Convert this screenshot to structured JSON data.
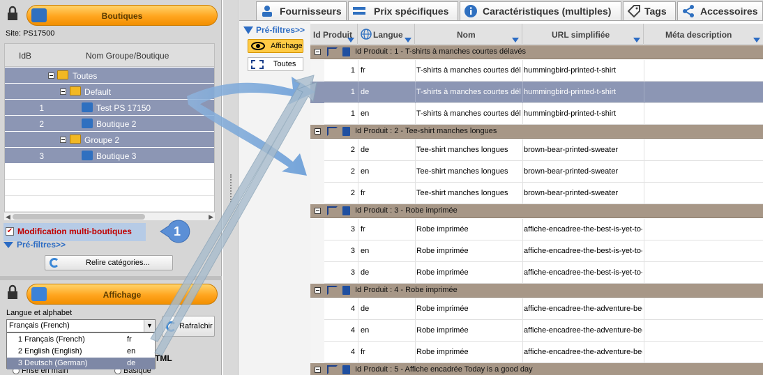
{
  "left": {
    "boutiques_title": "Boutiques",
    "site_label": "Site: PS17500",
    "grid_headers": {
      "idb": "IdB",
      "name": "Nom Groupe/Boutique"
    },
    "tree": [
      {
        "idb": "",
        "name": "Toutes"
      },
      {
        "idb": "",
        "name": "Default"
      },
      {
        "idb": "1",
        "name": "Test PS 17150"
      },
      {
        "idb": "2",
        "name": "Boutique 2"
      },
      {
        "idb": "",
        "name": "Groupe 2"
      },
      {
        "idb": "3",
        "name": "Boutique 3"
      }
    ],
    "multi_shop_label": "Modification multi-boutiques",
    "callout_number": "1",
    "prefilter_label": "Pré-filtres>>",
    "reload_label": "Relire catégories...",
    "affichage_title": "Affichage",
    "lang_label": "Langue et alphabet",
    "lang_selected": "Français (French)",
    "refresh_label": "Rafraîchir",
    "lang_options": [
      {
        "n": "1",
        "label": "Français (French)",
        "code": "fr"
      },
      {
        "n": "2",
        "label": "English (English)",
        "code": "en"
      },
      {
        "n": "3",
        "label": "Deutsch (German)",
        "code": "de"
      }
    ],
    "tml_label": "TML",
    "frise_label": "Frise en main",
    "basique_label": "Basique"
  },
  "tabs": [
    {
      "label": "Fournisseurs",
      "icon": "supplier-icon"
    },
    {
      "label": "Prix spécifiques",
      "icon": "price-icon"
    },
    {
      "label": "Caractéristiques (multiples)",
      "icon": "info-icon"
    },
    {
      "label": "Tags",
      "icon": "tag-icon"
    },
    {
      "label": "Accessoires",
      "icon": "share-icon"
    }
  ],
  "filters": {
    "prefilter_label": "Pré-filtres>>",
    "affichage_label": "Affichage",
    "toutes_label": "Toutes"
  },
  "grid": {
    "headers": {
      "id": "Id Produit",
      "lang": "Langue",
      "name": "Nom",
      "url": "URL simplifiée",
      "meta": "Méta description"
    },
    "groups": [
      {
        "title": "Id Produit : 1 - T-shirts à manches courtes délavés",
        "rows": [
          {
            "id": "1",
            "lang": "fr",
            "name": "T-shirts à manches courtes délavés",
            "url": "hummingbird-printed-t-shirt",
            "selected": false
          },
          {
            "id": "1",
            "lang": "de",
            "name": "T-shirts à manches courtes délavés",
            "url": "hummingbird-printed-t-shirt",
            "selected": true
          },
          {
            "id": "1",
            "lang": "en",
            "name": "T-shirts à manches courtes délavés",
            "url": "hummingbird-printed-t-shirt",
            "selected": false
          }
        ]
      },
      {
        "title": "Id Produit : 2 - Tee-shirt manches longues",
        "rows": [
          {
            "id": "2",
            "lang": "de",
            "name": "Tee-shirt manches longues",
            "url": "brown-bear-printed-sweater",
            "selected": false
          },
          {
            "id": "2",
            "lang": "en",
            "name": "Tee-shirt manches longues",
            "url": "brown-bear-printed-sweater",
            "selected": false
          },
          {
            "id": "2",
            "lang": "fr",
            "name": "Tee-shirt manches longues",
            "url": "brown-bear-printed-sweater",
            "selected": false
          }
        ]
      },
      {
        "title": "Id Produit : 3 - Robe imprimée",
        "rows": [
          {
            "id": "3",
            "lang": "fr",
            "name": "Robe imprimée",
            "url": "affiche-encadree-the-best-is-yet-to-come",
            "selected": false
          },
          {
            "id": "3",
            "lang": "en",
            "name": "Robe imprimée",
            "url": "affiche-encadree-the-best-is-yet-to-come",
            "selected": false
          },
          {
            "id": "3",
            "lang": "de",
            "name": "Robe imprimée",
            "url": "affiche-encadree-the-best-is-yet-to-come",
            "selected": false
          }
        ]
      },
      {
        "title": "Id Produit : 4 - Robe imprimée",
        "rows": [
          {
            "id": "4",
            "lang": "de",
            "name": "Robe imprimée",
            "url": "affiche-encadree-the-adventure-begins",
            "selected": false
          },
          {
            "id": "4",
            "lang": "en",
            "name": "Robe imprimée",
            "url": "affiche-encadree-the-adventure-begins",
            "selected": false
          },
          {
            "id": "4",
            "lang": "fr",
            "name": "Robe imprimée",
            "url": "affiche-encadree-the-adventure-begins",
            "selected": false
          }
        ]
      },
      {
        "title": "Id Produit : 5 - Affiche encadrée Today is a good day",
        "rows": []
      }
    ]
  },
  "colors": {
    "accent_orange": "#ffa51f",
    "selection": "#8c96b4",
    "group_header": "#a79787",
    "link_blue": "#2c6cc4",
    "warning_red": "#c00000"
  }
}
